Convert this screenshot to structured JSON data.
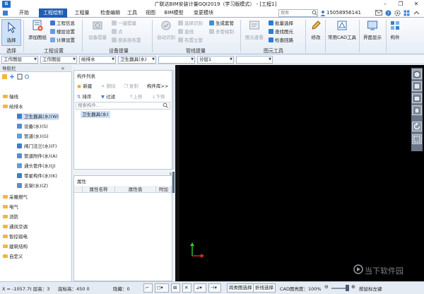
{
  "window": {
    "logo": "G",
    "title": "广联达BIM安装计量GQI2019（学习版模式） - [工程1]",
    "min": "–",
    "max": "❐",
    "close": "✕"
  },
  "tabs": [
    "开始",
    "工程绘制",
    "工程量",
    "检查编辑",
    "工具",
    "视图",
    "BIM模型",
    "变更模块"
  ],
  "active_tab": 1,
  "search": {
    "placeholder": "搜索"
  },
  "phone": "15058956141",
  "ribbon": {
    "select": {
      "label": "选择",
      "group": "选择"
    },
    "project_settings": {
      "group": "工程设置",
      "add_drawing": "添加图纸",
      "info": "工程信息",
      "floor_settings": "楼层设置",
      "calc_settings": "计算设置"
    },
    "device_extract": {
      "group": "设备提量",
      "device_extract": "设备提量",
      "one_key": "一键提量",
      "point": "点",
      "layout_by_system": "按系统布置"
    },
    "pipe_extract": {
      "group": "管线提量",
      "auto_identify": "自动识别",
      "select_identify": "选择识别",
      "line": "直线",
      "arrange_riser": "布置立管",
      "generate_fitting": "生成套管",
      "multi_tube": "多管绘制"
    },
    "drawing_tools": {
      "group": "图元工具",
      "view_by_layer": "图元查看",
      "batch_select": "批量选择",
      "find_element": "查找图元",
      "check_loop": "检查回路"
    },
    "modify": "修改",
    "cad_tools": "常用CAD工具",
    "interface": "界面显示",
    "component": "构件"
  },
  "toolrow": {
    "combo1": "工作图层",
    "combo2": "工作图层",
    "combo3": "给排水",
    "combo4": "卫生器具(水)",
    "combo5": "",
    "combo6": "分层1",
    "combo7": ""
  },
  "nav": {
    "title": "导航栏",
    "items": [
      {
        "label": "轴线",
        "type": "folder"
      },
      {
        "label": "给排水",
        "type": "folder"
      },
      {
        "label": "卫生器具(水)(W)",
        "type": "child",
        "selected": true
      },
      {
        "label": "设备(水)(S)",
        "type": "child"
      },
      {
        "label": "管道(水)(G)",
        "type": "child"
      },
      {
        "label": "阀门法兰(水)(F)",
        "type": "child"
      },
      {
        "label": "管道附件(水)(A)",
        "type": "child"
      },
      {
        "label": "通头管件(水)(J)",
        "type": "child"
      },
      {
        "label": "零星构件(水)(K)",
        "type": "child"
      },
      {
        "label": "支架(水)(Z)",
        "type": "child"
      },
      {
        "label": "采暖燃气",
        "type": "folder"
      },
      {
        "label": "电气",
        "type": "folder"
      },
      {
        "label": "消防",
        "type": "folder"
      },
      {
        "label": "通风空调",
        "type": "folder"
      },
      {
        "label": "智控弱电",
        "type": "folder"
      },
      {
        "label": "建筑结构",
        "type": "folder"
      },
      {
        "label": "自定义",
        "type": "folder"
      }
    ]
  },
  "component_list": {
    "title": "构件列表",
    "new": "新建",
    "delete": "删除",
    "copy": "复制",
    "library": "构件库>>",
    "sort": "排序",
    "filter": "过滤",
    "move_up": "上移",
    "move_down": "下移",
    "search_placeholder": "搜索构件...",
    "group_label": "卫生器具(水)"
  },
  "properties": {
    "title": "属性",
    "col_name": "属性名称",
    "col_value": "属性值",
    "col_extra": "附加"
  },
  "status": {
    "coords": "X = -1057.7t 层高：3",
    "elevation": "底标高：450 0",
    "hidden": "隐藏：0",
    "cross_layer": "跨类图选择",
    "polyline": "折线选择",
    "cad_brightness": "CAD图亮度：100%",
    "press_left": "按鼠标左键",
    "watermark": "当下软件园"
  }
}
